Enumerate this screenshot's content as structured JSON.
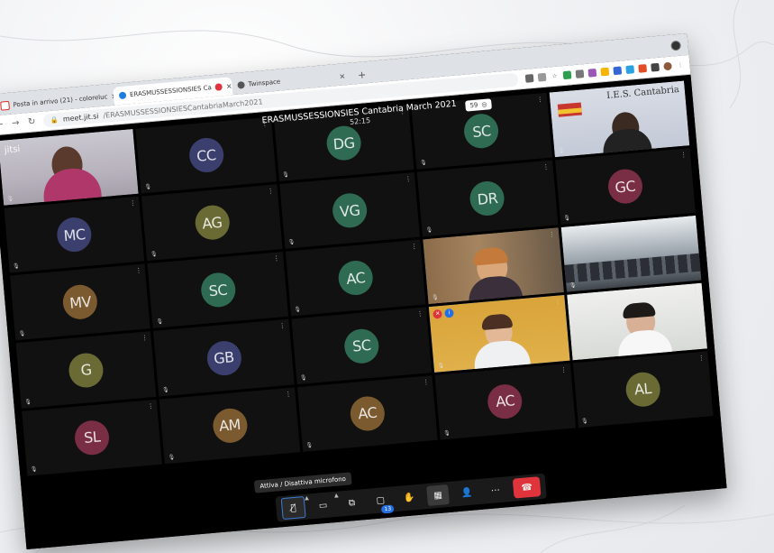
{
  "browser": {
    "tabs": [
      {
        "label": "Posta in arrivo (21) - coloreluc",
        "active": false,
        "icon": "gmail-icon"
      },
      {
        "label": "ERASMUSSESSIONSIES Ca",
        "active": true,
        "icon": "jitsi-icon"
      },
      {
        "label": "Twinspace",
        "active": false,
        "icon": "twinspace-icon"
      }
    ],
    "url_host": "meet.jit.si",
    "url_path": "/ERASMUSSESSIONSIESCantabriaMarch2021"
  },
  "meeting": {
    "title": "ERASMUSSESSIONSIES Cantabria March 2021",
    "timer": "52:15",
    "participant_count": "59",
    "watermark": "jitsi",
    "school_sign": "I.E.S. Cantabria"
  },
  "tiles": [
    {
      "type": "video",
      "id": "host-video"
    },
    {
      "type": "avatar",
      "initials": "CC",
      "color": "#3b3f6e"
    },
    {
      "type": "avatar",
      "initials": "DG",
      "color": "#2f6b52"
    },
    {
      "type": "avatar",
      "initials": "SC",
      "color": "#2f6b52"
    },
    {
      "type": "video",
      "id": "school-video"
    },
    {
      "type": "avatar",
      "initials": "MC",
      "color": "#3b3f6e"
    },
    {
      "type": "avatar",
      "initials": "AG",
      "color": "#6a6a34"
    },
    {
      "type": "avatar",
      "initials": "VG",
      "color": "#2f6b52"
    },
    {
      "type": "avatar",
      "initials": "DR",
      "color": "#2f6b52"
    },
    {
      "type": "avatar",
      "initials": "GC",
      "color": "#7a2e45"
    },
    {
      "type": "avatar",
      "initials": "MV",
      "color": "#7a5a2e"
    },
    {
      "type": "avatar",
      "initials": "SC",
      "color": "#2f6b52"
    },
    {
      "type": "avatar",
      "initials": "AC",
      "color": "#2f6b52"
    },
    {
      "type": "video",
      "id": "teacher-video"
    },
    {
      "type": "video",
      "id": "classroom-video"
    },
    {
      "type": "avatar",
      "initials": "G",
      "color": "#6a6a34"
    },
    {
      "type": "avatar",
      "initials": "GB",
      "color": "#3b3f6e"
    },
    {
      "type": "avatar",
      "initials": "SC",
      "color": "#2f6b52"
    },
    {
      "type": "video",
      "id": "speaker-video"
    },
    {
      "type": "video",
      "id": "student-video"
    },
    {
      "type": "avatar",
      "initials": "SL",
      "color": "#7a2e45"
    },
    {
      "type": "avatar",
      "initials": "AM",
      "color": "#7a5a2e"
    },
    {
      "type": "avatar",
      "initials": "AC",
      "color": "#7a5a2e"
    },
    {
      "type": "avatar",
      "initials": "AC",
      "color": "#7a2e45"
    },
    {
      "type": "avatar",
      "initials": "AL",
      "color": "#6a6a34"
    }
  ],
  "controls": {
    "tooltip": "Attiva / Disattiva microfono",
    "participants_badge": "13"
  }
}
